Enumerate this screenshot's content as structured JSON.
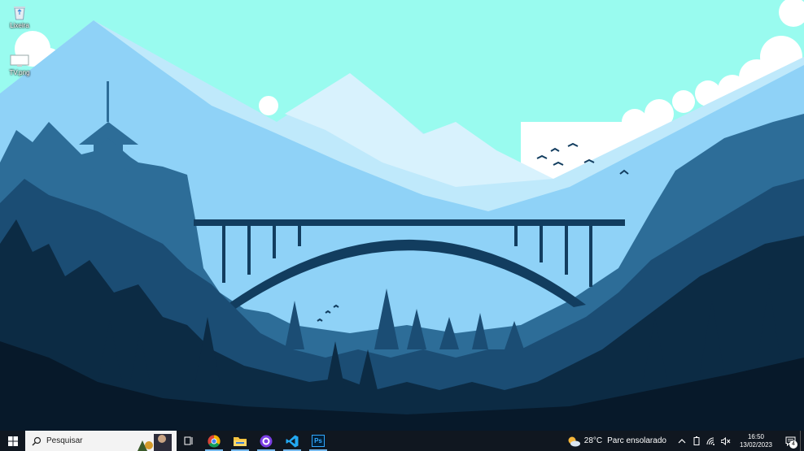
{
  "desktop": {
    "icons": [
      {
        "label": "Lixeira",
        "icon": "recycle-bin-icon"
      },
      {
        "label": "TV.png",
        "icon": "image-file-icon"
      }
    ]
  },
  "taskbar": {
    "start_icon": "windows-logo-icon",
    "search": {
      "placeholder": "Pesquisar"
    },
    "task_view_icon": "task-view-icon",
    "apps": [
      {
        "name": "chrome-icon"
      },
      {
        "name": "file-explorer-icon"
      },
      {
        "name": "github-desktop-icon"
      },
      {
        "name": "vscode-icon"
      },
      {
        "name": "photoshop-icon",
        "text": "Ps"
      }
    ],
    "weather": {
      "temp": "28°C",
      "desc": "Parc ensolarado",
      "icon": "sun-cloud-icon"
    },
    "tray_icons": [
      "chevron-up-icon",
      "battery-icon",
      "network-icon",
      "volume-muted-icon"
    ],
    "clock": {
      "time": "16:50",
      "date": "13/02/2023"
    },
    "notifications": {
      "count": "4",
      "icon": "notification-icon"
    }
  },
  "colors": {
    "sky": "#99fbef",
    "taskbar": "#101720",
    "search_bg": "#f3f3f3"
  }
}
